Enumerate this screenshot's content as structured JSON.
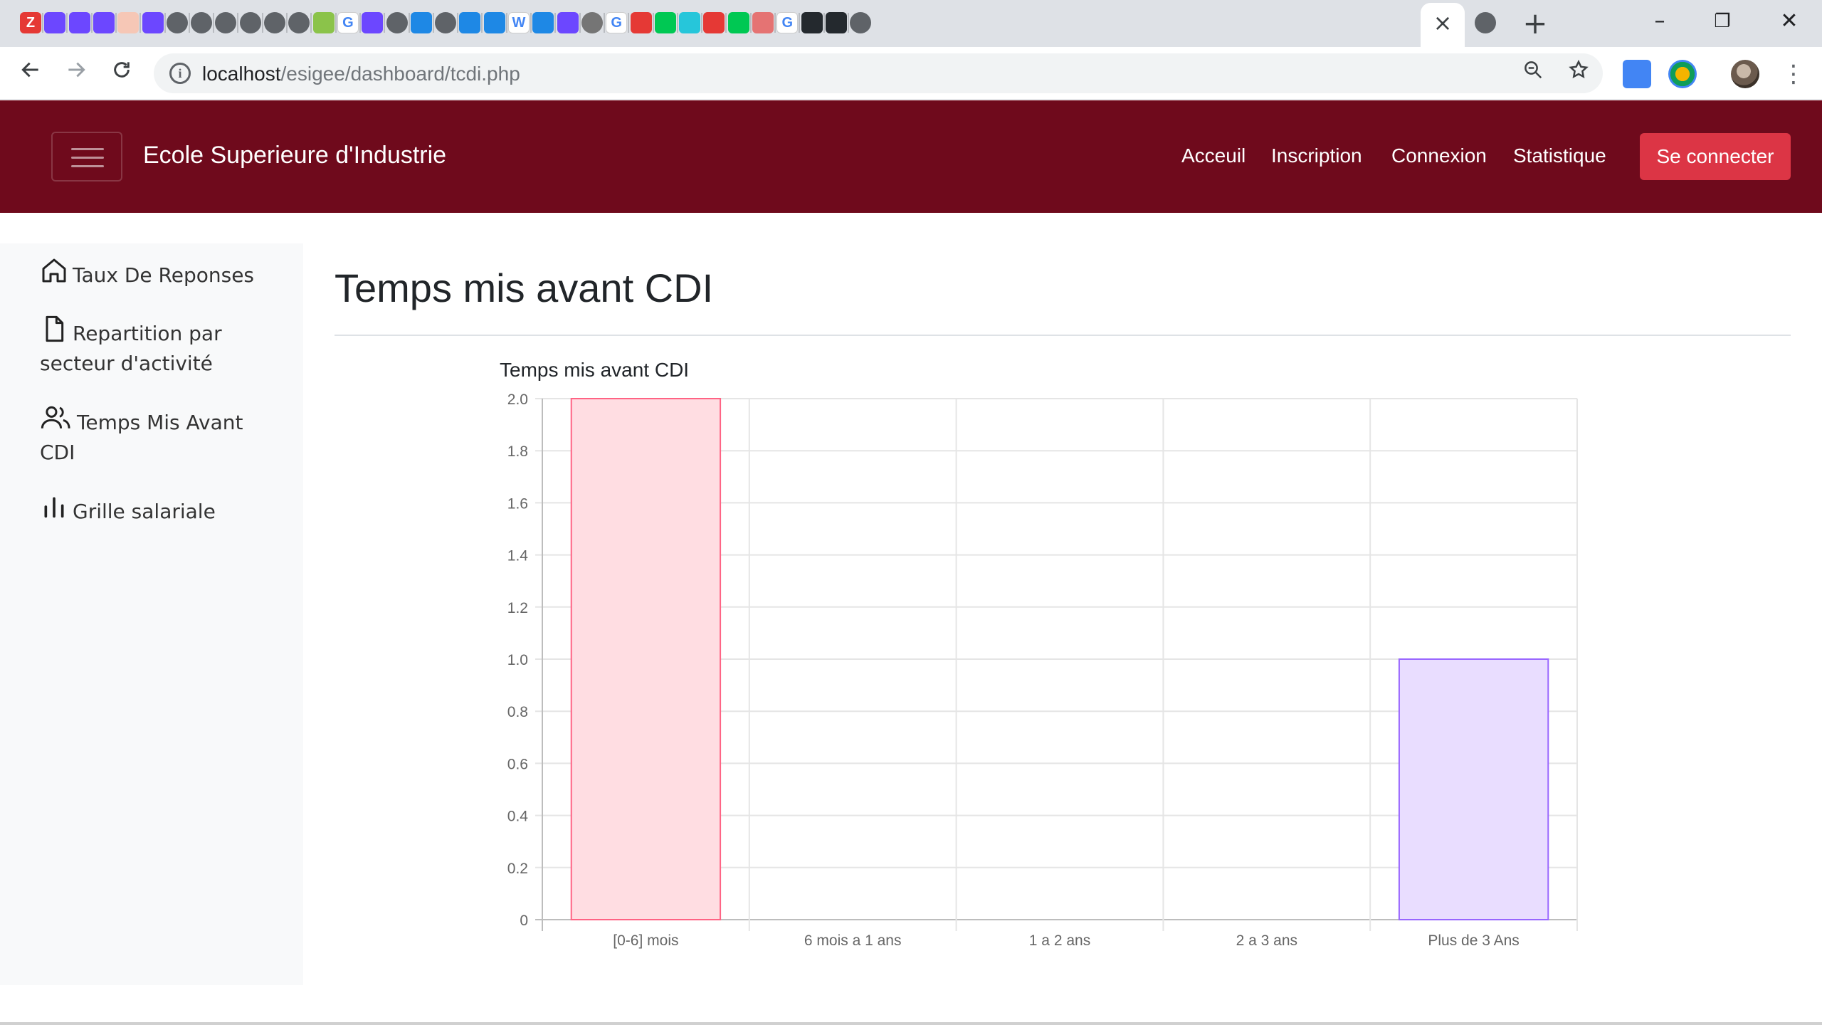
{
  "browser": {
    "url_host": "localhost",
    "url_path": "/esigee/dashboard/tcdi.php",
    "active_tab_close": "×",
    "new_tab": "+"
  },
  "navbar": {
    "brand": "Ecole Superieure d'Industrie",
    "links": [
      "Acceuil",
      "Inscription",
      "Connexion",
      "Statistique"
    ],
    "login_button": "Se connecter",
    "color": "#6f0a1c",
    "button_color": "#dc3545"
  },
  "sidebar": {
    "items": [
      {
        "icon": "home-icon",
        "label": "Taux De Reponses"
      },
      {
        "icon": "file-icon",
        "label": "Repartition par secteur d'activité"
      },
      {
        "icon": "users-icon",
        "label": "Temps Mis Avant CDI"
      },
      {
        "icon": "bar-chart-icon",
        "label": "Grille salariale"
      }
    ]
  },
  "main": {
    "title": "Temps mis avant CDI"
  },
  "chart_data": {
    "type": "bar",
    "title": "Temps mis avant CDI",
    "categories": [
      "[0-6] mois",
      "6 mois a 1 ans",
      "1 a 2 ans",
      "2 a 3 ans",
      "Plus de 3 Ans"
    ],
    "values": [
      2,
      0,
      0,
      0,
      1
    ],
    "colors": [
      "#ffdde2",
      "#e0f0ff",
      "#fff0d8",
      "#daf3f3",
      "#e9ddff"
    ],
    "border_colors": [
      "#ff6384",
      "#36a2eb",
      "#ffce56",
      "#4bc0c0",
      "#9966ff"
    ],
    "ylim": [
      0,
      2
    ],
    "yticks": [
      "0",
      "0.2",
      "0.4",
      "0.6",
      "0.8",
      "1.0",
      "1.2",
      "1.4",
      "1.6",
      "1.8",
      "2.0"
    ],
    "grid": true,
    "legend": "none"
  }
}
